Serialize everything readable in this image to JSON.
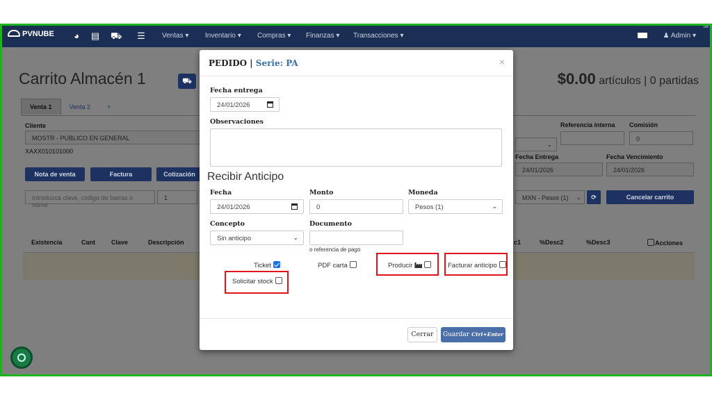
{
  "navbar": {
    "logo_text": "PVNUBE",
    "menus": [
      "Ventas",
      "Inventario",
      "Compras",
      "Finanzas",
      "Transacciones"
    ],
    "user": "Admin",
    "version": "58"
  },
  "page": {
    "title": "Carrito Almacén 1",
    "totals_amount": "$0.00",
    "totals_rest": "artículos | 0 partidas",
    "tabs": [
      "Venta 1",
      "Venta 2",
      "+"
    ],
    "cliente_label": "Cliente",
    "cliente_value": "MOSTR - PUBLICO EN GENERAL",
    "rfc": "XAXX010101000",
    "ref_interna_label": "Referencia interna",
    "comision_label": "Comisión",
    "comision_value": "0",
    "fecha_entrega_label": "Fecha Entrega",
    "fecha_entrega_value": "24/01/2026",
    "fecha_venc_label": "Fecha Vencimiento",
    "fecha_venc_value": "24/01/2026",
    "btn_nota": "Nota de venta",
    "btn_factura": "Factura",
    "btn_cotizacion": "Cotización",
    "search_placeholder": "Introduzca clave, código de barras o núme",
    "qty_value": "1",
    "currency_value": "MXN - Pesos (1)",
    "btn_cancelar": "Cancelar carrito",
    "columns": [
      "Existencia",
      "Cant",
      "Clave",
      "Descripción",
      "c1",
      "%Desc2",
      "%Desc3",
      "Acciones"
    ]
  },
  "modal": {
    "title": "PEDIDO",
    "serie": "Serie: PA",
    "close": "×",
    "fecha_entrega_label": "Fecha entrega",
    "fecha_entrega_value": "24/01/2026",
    "observaciones_label": "Observaciones",
    "section_title": "Recibir Anticipo",
    "fecha_label": "Fecha",
    "fecha_value": "24/01/2026",
    "monto_label": "Monto",
    "monto_value": "0",
    "moneda_label": "Moneda",
    "moneda_value": "Pesos (1)",
    "concepto_label": "Concepto",
    "concepto_value": "Sin anticipo",
    "documento_label": "Documento",
    "documento_hint": "o referencia de pago",
    "cb_ticket": "Ticket",
    "cb_pdf": "PDF carta",
    "cb_producir": "Producir",
    "cb_facturar": "Facturar anticipo",
    "cb_stock": "Solicitar stock",
    "btn_cerrar": "Cerrar",
    "btn_guardar": "Guardar",
    "btn_guardar_kbd": "Ctrl+Enter"
  },
  "colors": {
    "highlight": "#e0131b",
    "frame": "#1db31d",
    "navbar": "#1b2e54",
    "primary": "#4a6ea8"
  }
}
